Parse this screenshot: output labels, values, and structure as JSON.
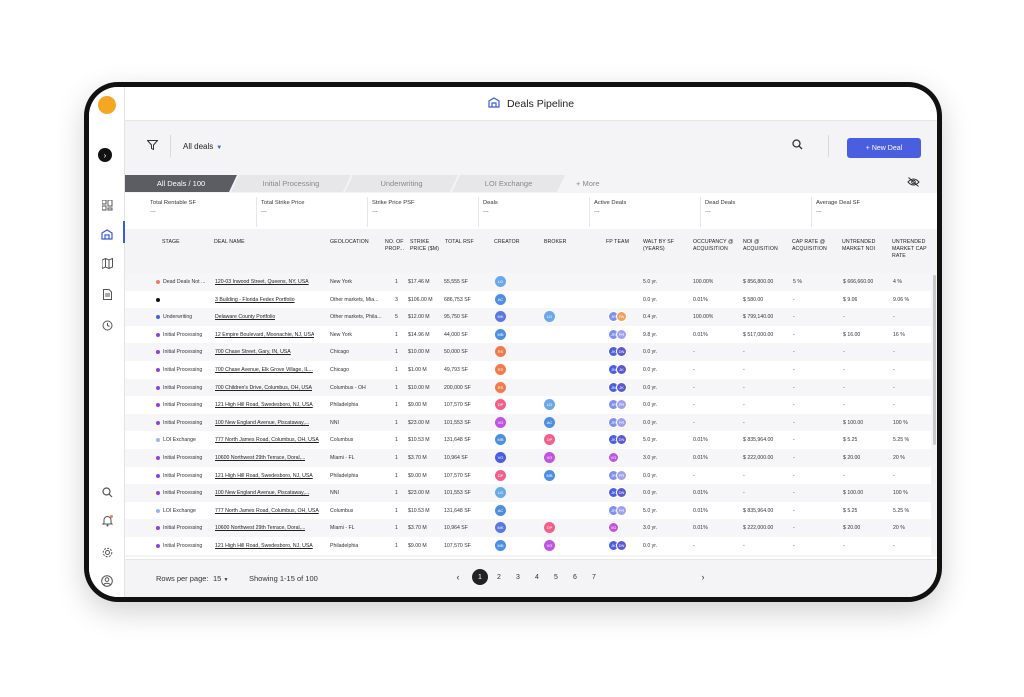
{
  "header": {
    "title": "Deals Pipeline",
    "icon": "deals-pipeline-icon"
  },
  "toolbar": {
    "filter_label": "All deals",
    "new_deal_label": "+ New Deal"
  },
  "tabs": [
    {
      "label": "All Deals / 100",
      "active": true
    },
    {
      "label": "Initial Processing"
    },
    {
      "label": "Underwriting"
    },
    {
      "label": "LOI Exchange"
    }
  ],
  "tab_more": "+ More",
  "stats": [
    {
      "label": "Total Rentable SF",
      "value": "..."
    },
    {
      "label": "Total Strike Price",
      "value": "..."
    },
    {
      "label": "Strike Price PSF",
      "value": "..."
    },
    {
      "label": "Deals",
      "value": "..."
    },
    {
      "label": "Active Deals",
      "value": "..."
    },
    {
      "label": "Dead Deals",
      "value": "..."
    },
    {
      "label": "Average Deal SF",
      "value": "..."
    }
  ],
  "columns": [
    "STAGE",
    "DEAL NAME",
    "GEOLOCATION",
    "NO. OF PROP...",
    "STRIKE PRICE ($M)",
    "TOTAL RSF",
    "CREATOR",
    "BROKER",
    "FP TEAM",
    "WALT BY SF (YEARS)",
    "OCCUPANCY @ ACQUISITION",
    "NOI @ ACQUISITION",
    "CAP RATE @ ACQUISITION",
    "UNTRENDED MARKET NOI",
    "UNTRENDED MARKET CAP RATE"
  ],
  "rows": [
    {
      "stage": "Dead Deals Not ...",
      "stage_color": "#f07b6b",
      "name": "120-03 Inwood Street, Queens, NY, USA",
      "geo": "New York",
      "props": "1",
      "price": "$17.46 M",
      "rsf": "55,555 SF",
      "creator": "LG",
      "creator_color": "#6aa8e8",
      "broker": "",
      "broker_color": "",
      "fp": [],
      "walt": "5.0 yr.",
      "occ": "100.00%",
      "noi": "$ 856,800.00",
      "cap": "5 %",
      "unoi": "$ 666,660.00",
      "ucap": "4 %"
    },
    {
      "stage": "",
      "stage_color": "#111111",
      "name": "3 Building - Florida Fedex Portfolio",
      "geo": "Other markets, Mia...",
      "props": "3",
      "price": "$106.00 M",
      "rsf": "686,753 SF",
      "creator": "AC",
      "creator_color": "#4f8fe0",
      "broker": "",
      "broker_color": "",
      "fp": [],
      "walt": "0.0 yr.",
      "occ": "0.01%",
      "noi": "$ 580.00",
      "cap": "-",
      "unoi": "$ 9.06",
      "ucap": "9.06 %"
    },
    {
      "stage": "Underwriting",
      "stage_color": "#4a5fe0",
      "name": "Delaware County Portfolio",
      "geo": "Other markets, Phila...",
      "props": "5",
      "price": "$12.00 M",
      "rsf": "95,750 SF",
      "creator": "MK",
      "creator_color": "#5a78e0",
      "broker": "LG",
      "broker_color": "#6aa8e8",
      "fp": [
        [
          "JR",
          "#7d8ff0"
        ],
        [
          "PA",
          "#f0a05a"
        ]
      ],
      "walt": "0.4 yr.",
      "occ": "100.00%",
      "noi": "$ 799,140.00",
      "cap": "-",
      "unoi": "-",
      "ucap": "-"
    },
    {
      "stage": "Initial Processing",
      "stage_color": "#8e44d9",
      "name": "12 Empire Boulevard, Moonachie, NJ, USA",
      "geo": "New York",
      "props": "1",
      "price": "$14.96 M",
      "rsf": "44,000 SF",
      "creator": "MB",
      "creator_color": "#4f8fe0",
      "broker": "",
      "broker_color": "",
      "fp": [
        [
          "JR",
          "#7d8ff0"
        ],
        [
          "PR",
          "#a0a0f0"
        ]
      ],
      "walt": "9.8 yr.",
      "occ": "0.01%",
      "noi": "$ 517,000.00",
      "cap": "-",
      "unoi": "$ 16.00",
      "ucap": "16 %"
    },
    {
      "stage": "Initial Processing",
      "stage_color": "#8e44d9",
      "name": "700 Chase Street, Gary, IN, USA",
      "geo": "Chicago",
      "props": "1",
      "price": "$10.00 M",
      "rsf": "50,000 SF",
      "creator": "RS",
      "creator_color": "#f07b4b",
      "broker": "",
      "broker_color": "",
      "fp": [
        [
          "JK",
          "#4a5fe0"
        ],
        [
          "DN",
          "#5a5ad0"
        ]
      ],
      "walt": "0.0 yr.",
      "occ": "-",
      "noi": "-",
      "cap": "-",
      "unoi": "-",
      "ucap": "-"
    },
    {
      "stage": "Initial Processing",
      "stage_color": "#8e44d9",
      "name": "700 Chase Avenue, Elk Grove Village, IL...",
      "geo": "Chicago",
      "props": "1",
      "price": "$1.00 M",
      "rsf": "49,793 SF",
      "creator": "RS",
      "creator_color": "#f07b4b",
      "broker": "",
      "broker_color": "",
      "fp": [
        [
          "JN",
          "#4a5fe0"
        ],
        [
          "JK",
          "#5a5ad0"
        ]
      ],
      "walt": "0.0 yr.",
      "occ": "-",
      "noi": "-",
      "cap": "-",
      "unoi": "-",
      "ucap": "-"
    },
    {
      "stage": "Initial Processing",
      "stage_color": "#8e44d9",
      "name": "700 Children's Drive, Columbus, OH, USA",
      "geo": "Columbus - OH",
      "props": "1",
      "price": "$10.00 M",
      "rsf": "200,000 SF",
      "creator": "RS",
      "creator_color": "#f07b4b",
      "broker": "",
      "broker_color": "",
      "fp": [
        [
          "JN",
          "#4a5fe0"
        ],
        [
          "JK",
          "#5a5ad0"
        ]
      ],
      "walt": "0.0 yr.",
      "occ": "-",
      "noi": "-",
      "cap": "-",
      "unoi": "-",
      "ucap": "-"
    },
    {
      "stage": "Initial Processing",
      "stage_color": "#8e44d9",
      "name": "121 High Hill Road, Swedesboro, NJ, USA",
      "geo": "Philadelphia",
      "props": "1",
      "price": "$9.00 M",
      "rsf": "107,570 SF",
      "creator": "DP",
      "creator_color": "#f0608a",
      "broker": "LG",
      "broker_color": "#6aa8e8",
      "fp": [
        [
          "JR",
          "#7d8ff0"
        ],
        [
          "PR",
          "#a0a0f0"
        ]
      ],
      "walt": "0.0 yr.",
      "occ": "-",
      "noi": "-",
      "cap": "-",
      "unoi": "-",
      "ucap": "-"
    },
    {
      "stage": "Initial Processing",
      "stage_color": "#8e44d9",
      "name": "100 New England Avenue, Piscataway,...",
      "geo": "NNI",
      "props": "1",
      "price": "$23.00 M",
      "rsf": "101,553 SF",
      "creator": "VG",
      "creator_color": "#c054e0",
      "broker": "AC",
      "broker_color": "#4f8fe0",
      "fp": [
        [
          "JR",
          "#7d8ff0"
        ],
        [
          "PR",
          "#a0a0f0"
        ]
      ],
      "walt": "0.0 yr.",
      "occ": "-",
      "noi": "-",
      "cap": "-",
      "unoi": "$ 100.00",
      "ucap": "100 %"
    },
    {
      "stage": "LOI Exchange",
      "stage_color": "#9db4f0",
      "name": "777 North James Road, Columbus, OH, USA",
      "geo": "Columbus",
      "props": "1",
      "price": "$10.53 M",
      "rsf": "131,648 SF",
      "creator": "MB",
      "creator_color": "#4f8fe0",
      "broker": "DP",
      "broker_color": "#f0608a",
      "fp": [
        [
          "JK",
          "#4a5fe0"
        ],
        [
          "DN",
          "#5a5ad0"
        ]
      ],
      "walt": "5.0 yr.",
      "occ": "0.01%",
      "noi": "$ 835,964.00",
      "cap": "-",
      "unoi": "$ 5.25",
      "ucap": "5.25 %"
    },
    {
      "stage": "Initial Processing",
      "stage_color": "#8e44d9",
      "name": "10600 Northwest 29th Terrace, Doral,...",
      "geo": "Miami - FL",
      "props": "1",
      "price": "$3.70 M",
      "rsf": "10,964 SF",
      "creator": "VG",
      "creator_color": "#4a5fe0",
      "broker": "VG",
      "broker_color": "#c054e0",
      "fp": [
        [
          "VG",
          "#c054e0"
        ]
      ],
      "walt": "3.0 yr.",
      "occ": "0.01%",
      "noi": "$ 222,000.00",
      "cap": "-",
      "unoi": "$ 20.00",
      "ucap": "20 %"
    },
    {
      "stage": "Initial Processing",
      "stage_color": "#8e44d9",
      "name": "121 High Hill Road, Swedesboro, NJ, USA",
      "geo": "Philadelphia",
      "props": "1",
      "price": "$9.00 M",
      "rsf": "107,570 SF",
      "creator": "DP",
      "creator_color": "#f0608a",
      "broker": "MB",
      "broker_color": "#4f8fe0",
      "fp": [
        [
          "JR",
          "#7d8ff0"
        ],
        [
          "PR",
          "#a0a0f0"
        ]
      ],
      "walt": "0.0 yr.",
      "occ": "-",
      "noi": "-",
      "cap": "-",
      "unoi": "-",
      "ucap": "-"
    },
    {
      "stage": "Initial Processing",
      "stage_color": "#8e44d9",
      "name": "100 New England Avenue, Piscataway,...",
      "geo": "NNI",
      "props": "1",
      "price": "$23.00 M",
      "rsf": "101,553 SF",
      "creator": "LG",
      "creator_color": "#6aa8e8",
      "broker": "",
      "broker_color": "",
      "fp": [
        [
          "JK",
          "#4a5fe0"
        ],
        [
          "DN",
          "#5a5ad0"
        ]
      ],
      "walt": "0.0 yr.",
      "occ": "0.01%",
      "noi": "-",
      "cap": "-",
      "unoi": "$ 100.00",
      "ucap": "100 %"
    },
    {
      "stage": "LOI Exchange",
      "stage_color": "#9db4f0",
      "name": "777 North James Road, Columbus, OH, USA",
      "geo": "Columbus",
      "props": "1",
      "price": "$10.53 M",
      "rsf": "131,648 SF",
      "creator": "AC",
      "creator_color": "#4f8fe0",
      "broker": "",
      "broker_color": "",
      "fp": [
        [
          "JR",
          "#7d8ff0"
        ],
        [
          "PR",
          "#a0a0f0"
        ]
      ],
      "walt": "5.0 yr.",
      "occ": "0.01%",
      "noi": "$ 835,964.00",
      "cap": "-",
      "unoi": "$ 5.25",
      "ucap": "5.25 %"
    },
    {
      "stage": "Initial Processing",
      "stage_color": "#8e44d9",
      "name": "10600 Northwest 29th Terrace, Doral,...",
      "geo": "Miami - FL",
      "props": "1",
      "price": "$3.70 M",
      "rsf": "10,964 SF",
      "creator": "MK",
      "creator_color": "#5a78e0",
      "broker": "DP",
      "broker_color": "#f0608a",
      "fp": [
        [
          "VG",
          "#c054e0"
        ]
      ],
      "walt": "3.0 yr.",
      "occ": "0.01%",
      "noi": "$ 222,000.00",
      "cap": "-",
      "unoi": "$ 20.00",
      "ucap": "20 %"
    },
    {
      "stage": "Initial Processing",
      "stage_color": "#8e44d9",
      "name": "121 High Hill Road, Swedesboro, NJ, USA",
      "geo": "Philadelphia",
      "props": "1",
      "price": "$9.00 M",
      "rsf": "107,570 SF",
      "creator": "MB",
      "creator_color": "#4f8fe0",
      "broker": "VG",
      "broker_color": "#c054e0",
      "fp": [
        [
          "JK",
          "#4a5fe0"
        ],
        [
          "DN",
          "#5a5ad0"
        ]
      ],
      "walt": "0.0 yr.",
      "occ": "-",
      "noi": "-",
      "cap": "-",
      "unoi": "-",
      "ucap": "-"
    }
  ],
  "footer": {
    "rows_per_page_label": "Rows per page:",
    "rows_per_page_value": "15",
    "showing": "Showing 1-15 of 100",
    "pages": [
      "1",
      "2",
      "3",
      "4",
      "5",
      "6",
      "7"
    ],
    "current_page": "1"
  }
}
